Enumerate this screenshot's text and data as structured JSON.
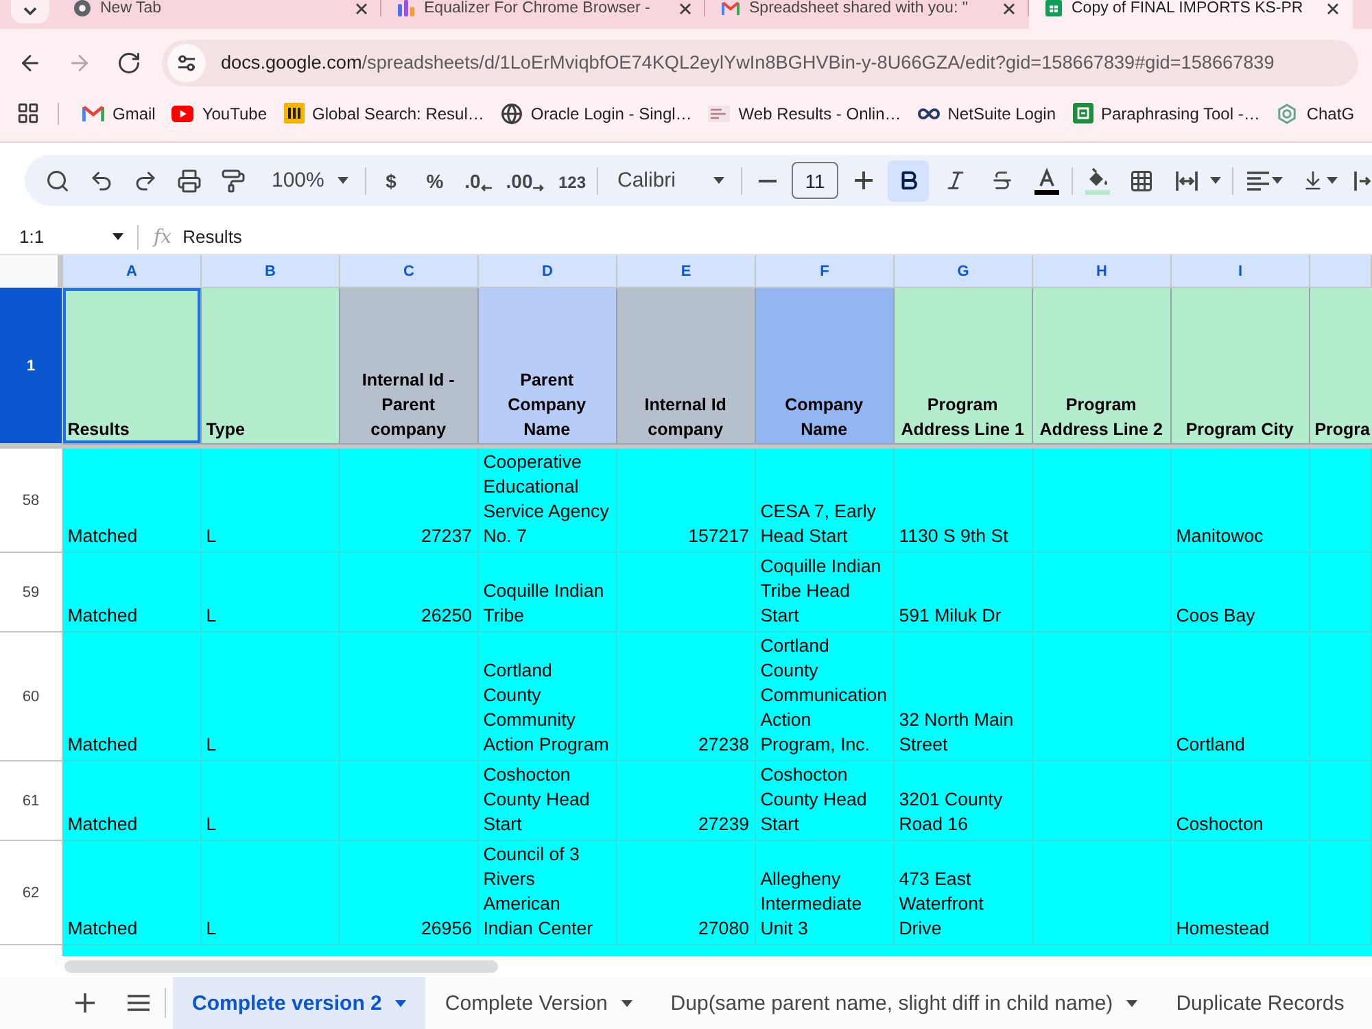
{
  "browser": {
    "tabs": [
      {
        "kind": "newtab",
        "title": "New Tab",
        "selected": false
      },
      {
        "kind": "extension",
        "title": "Equalizer For Chrome Browser -",
        "selected": false
      },
      {
        "kind": "mail",
        "title": "Spreadsheet shared with you: \"",
        "selected": false
      },
      {
        "kind": "sheet",
        "title": "Copy of FINAL IMPORTS KS-PR",
        "selected": true
      }
    ],
    "navigation": [
      {
        "kind": "back",
        "disabled": false
      },
      {
        "kind": "forward",
        "disabled": true
      },
      {
        "kind": "reload",
        "disabled": false
      }
    ],
    "address": {
      "host": "docs.google.com",
      "path": "/spreadsheets/d/1LoErMviqbfOE74KQL2eylYwIn8BGHVBin-y-8U66GZA/edit?gid=158667839#gid=158667839"
    },
    "bookmarks": [
      {
        "kind": "mail",
        "label": "Gmail"
      },
      {
        "kind": "video",
        "label": "YouTube"
      },
      {
        "kind": "bars",
        "label": "Global Search: Resul…"
      },
      {
        "kind": "globe",
        "label": "Oracle Login - Singl…"
      },
      {
        "kind": "image",
        "label": "Web Results - Onlin…"
      },
      {
        "kind": "loop",
        "label": "NetSuite Login"
      },
      {
        "kind": "doc",
        "label": "Paraphrasing Tool -…"
      },
      {
        "kind": "knot",
        "label": "ChatG"
      }
    ]
  },
  "toolbar": {
    "zoom": "100%",
    "number_buttons": [
      {
        "kind": "currency",
        "label": "$"
      },
      {
        "kind": "percent",
        "label": "%"
      },
      {
        "kind": "decimal_down",
        "label": ".0"
      },
      {
        "kind": "decimal_up",
        "label": ".00"
      },
      {
        "kind": "formats",
        "label": "123"
      }
    ],
    "font": "Calibri",
    "font_size": "11",
    "format_buttons": [
      {
        "kind": "bold",
        "on": true
      },
      {
        "kind": "italic",
        "on": false
      },
      {
        "kind": "strikethrough",
        "on": false
      }
    ]
  },
  "formula_bar": {
    "name_box": "1:1",
    "function_label": "fx",
    "value": "Results"
  },
  "sheet": {
    "columns": [
      {
        "letter": "A",
        "title": "Results",
        "color": "#b4ecce"
      },
      {
        "letter": "B",
        "title": "Type",
        "color": "#b4ecce"
      },
      {
        "letter": "C",
        "title": "Internal Id - Parent company",
        "color": "#b6bfcc"
      },
      {
        "letter": "D",
        "title": "Parent Company Name",
        "color": "#b7cdf7"
      },
      {
        "letter": "E",
        "title": "Internal Id company",
        "color": "#b6bfcc"
      },
      {
        "letter": "F",
        "title": "Company Name",
        "color": "#93b6f2"
      },
      {
        "letter": "G",
        "title": "Program Address Line 1",
        "color": "#b4ecce"
      },
      {
        "letter": "H",
        "title": "Program Address Line 2",
        "color": "#b4ecce"
      },
      {
        "letter": "I",
        "title": "Program City",
        "color": "#b4ecce"
      },
      {
        "title": "Progra",
        "color": "#b4ecce"
      }
    ],
    "header_row": {
      "number": "1",
      "selected": true
    },
    "rows": [
      {
        "number": "58",
        "selected": false,
        "results": "Matched",
        "type": "L",
        "internal_id_parent_company": "27237",
        "parent_company_name": "Cooperative Educational Service Agency No. 7",
        "internal_id_company": "157217",
        "company_name": "CESA 7, Early Head Start",
        "program_address_line_1": "1130 S 9th St",
        "program_city": "Manitowoc"
      },
      {
        "number": "59",
        "selected": false,
        "results": "Matched",
        "type": "L",
        "internal_id_parent_company": "26250",
        "parent_company_name": "Coquille Indian Tribe",
        "company_name": "Coquille Indian Tribe Head Start",
        "program_address_line_1": "591 Miluk Dr",
        "program_city": "Coos Bay"
      },
      {
        "number": "60",
        "selected": false,
        "results": "Matched",
        "type": "L",
        "parent_company_name": "Cortland County Community Action Program",
        "internal_id_company": "27238",
        "company_name": "Cortland County Communication Action Program, Inc.",
        "program_address_line_1": "32 North Main Street",
        "program_city": "Cortland"
      },
      {
        "number": "61",
        "selected": false,
        "results": "Matched",
        "type": "L",
        "parent_company_name": "Coshocton County Head Start",
        "internal_id_company": "27239",
        "company_name": "Coshocton County Head Start",
        "program_address_line_1": "3201 County Road 16",
        "program_city": "Coshocton"
      },
      {
        "number": "62",
        "selected": false,
        "results": "Matched",
        "type": "L",
        "internal_id_parent_company": "26956",
        "parent_company_name": "Council of 3 Rivers American Indian Center",
        "internal_id_company": "27080",
        "company_name": "Allegheny Intermediate Unit 3",
        "program_address_line_1": "473 East Waterfront Drive",
        "program_city": "Homestead"
      }
    ]
  },
  "sheet_tabs": [
    {
      "label": "Complete version 2",
      "selected": true
    },
    {
      "label": "Complete Version",
      "selected": false
    },
    {
      "label": "Dup(same parent name, slight diff in child name)",
      "selected": false
    },
    {
      "label": "Duplicate Records",
      "selected": false
    }
  ]
}
